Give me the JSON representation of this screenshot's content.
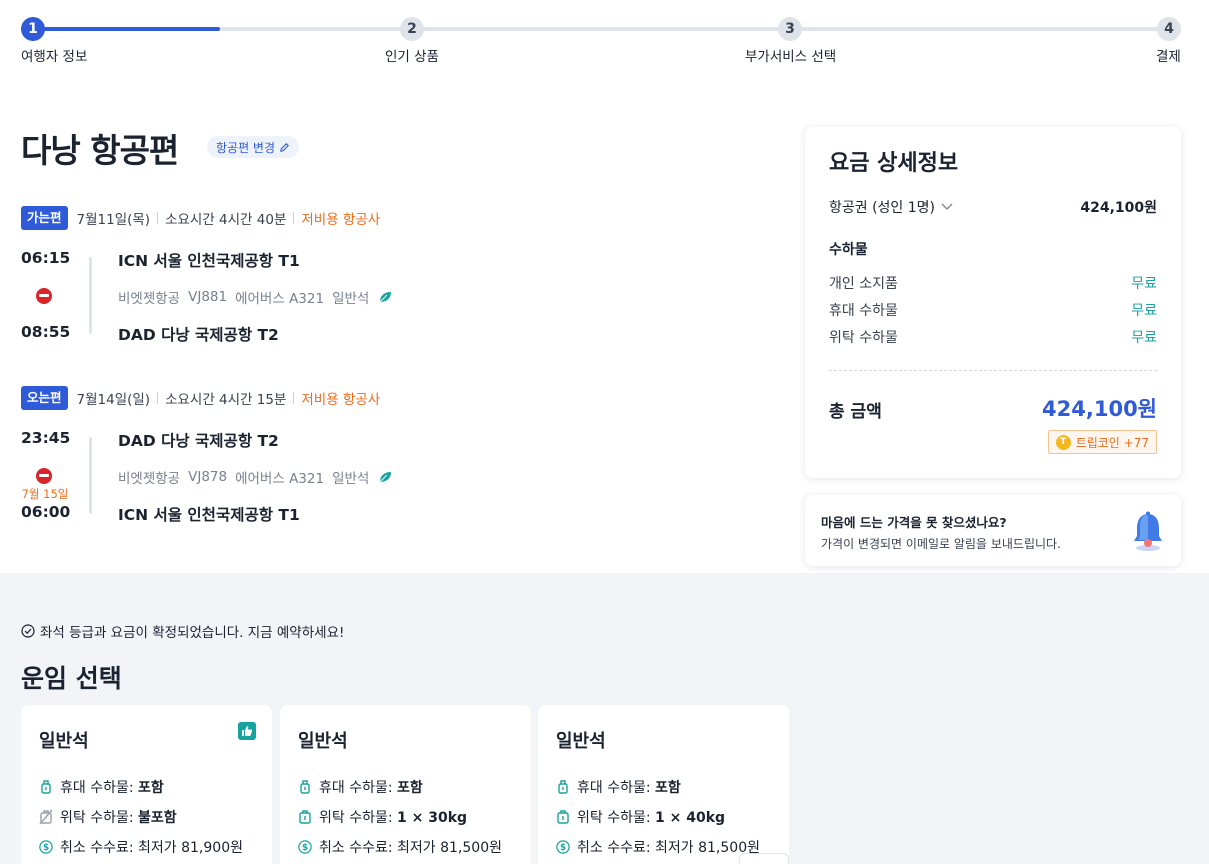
{
  "stepper": {
    "steps": [
      {
        "number": "1",
        "label": "여행자 정보"
      },
      {
        "number": "2",
        "label": "인기 상품"
      },
      {
        "number": "3",
        "label": "부가서비스 선택"
      },
      {
        "number": "4",
        "label": "결제"
      }
    ],
    "progress_fraction": 0.167
  },
  "header": {
    "title": "다낭 항공편",
    "change_flight_label": "항공편 변경"
  },
  "outbound": {
    "badge": "가는편",
    "date": "7월11일(목)",
    "duration": "소요시간 4시간 40분",
    "budget_label": "저비용 항공사",
    "depart_time": "06:15",
    "arrive_time": "08:55",
    "depart_airport": "ICN 서울 인천국제공항 T1",
    "arrive_airport": "DAD 다낭 국제공항 T2",
    "airline": "비엣젯항공",
    "flight_no": "VJ881",
    "aircraft": "에어버스 A321",
    "cabin": "일반석"
  },
  "return": {
    "badge": "오는편",
    "date": "7월14일(일)",
    "duration": "소요시간 4시간 15분",
    "budget_label": "저비용 항공사",
    "depart_time": "23:45",
    "arrive_time": "06:00",
    "next_day": "7월 15일",
    "depart_airport": "DAD 다낭 국제공항 T2",
    "arrive_airport": "ICN 서울 인천국제공항 T1",
    "airline": "비엣젯항공",
    "flight_no": "VJ878",
    "aircraft": "에어버스 A321",
    "cabin": "일반석"
  },
  "price_detail": {
    "title": "요금 상세정보",
    "fare_label": "항공권 (성인 1명)",
    "fare_value": "424,100원",
    "baggage_title": "수하물",
    "baggage": [
      {
        "label": "개인 소지품",
        "value": "무료"
      },
      {
        "label": "휴대 수하물",
        "value": "무료"
      },
      {
        "label": "위탁 수하물",
        "value": "무료"
      }
    ],
    "total_label": "총 금액",
    "total_value": "424,100원",
    "coin_label": "트립코인 +77"
  },
  "price_alert": {
    "title": "마음에 드는 가격을 못 찾으셨나요?",
    "subtitle": "가격이 변경되면 이메일로 알림을 보내드립니다."
  },
  "fare_selection": {
    "confirm_note": "좌석 등급과 요금이 확정되었습니다. 지금 예약하세요!",
    "title": "운임 선택",
    "cards": [
      {
        "title": "일반석",
        "recommended": true,
        "features": [
          {
            "label": "휴대 수하물: ",
            "value": "포함",
            "icon": "carry-on-bag-icon"
          },
          {
            "label": "위탁 수하물: ",
            "value": "불포함",
            "icon": "no-checked-bag-icon"
          },
          {
            "label": "취소 수수료: ",
            "value": "최저가 81,900원",
            "icon": "dollar-icon"
          }
        ]
      },
      {
        "title": "일반석",
        "recommended": false,
        "features": [
          {
            "label": "휴대 수하물: ",
            "value": "포함",
            "icon": "carry-on-bag-icon"
          },
          {
            "label": "위탁 수하물: ",
            "value": "1 × 30kg",
            "icon": "checked-bag-icon"
          },
          {
            "label": "취소 수수료: ",
            "value": "최저가 81,500원",
            "icon": "dollar-icon"
          }
        ]
      },
      {
        "title": "일반석",
        "recommended": false,
        "features": [
          {
            "label": "휴대 수하물: ",
            "value": "포함",
            "icon": "carry-on-bag-icon"
          },
          {
            "label": "위탁 수하물: ",
            "value": "1 × 40kg",
            "icon": "checked-bag-icon"
          },
          {
            "label": "취소 수수료: ",
            "value": "최저가 81,500원",
            "icon": "dollar-icon"
          }
        ]
      }
    ]
  },
  "colors": {
    "accent": "#2f5bd8",
    "budget": "#ef6b1a",
    "free": "#17a3a0",
    "section_bg": "#f2f4f8"
  }
}
